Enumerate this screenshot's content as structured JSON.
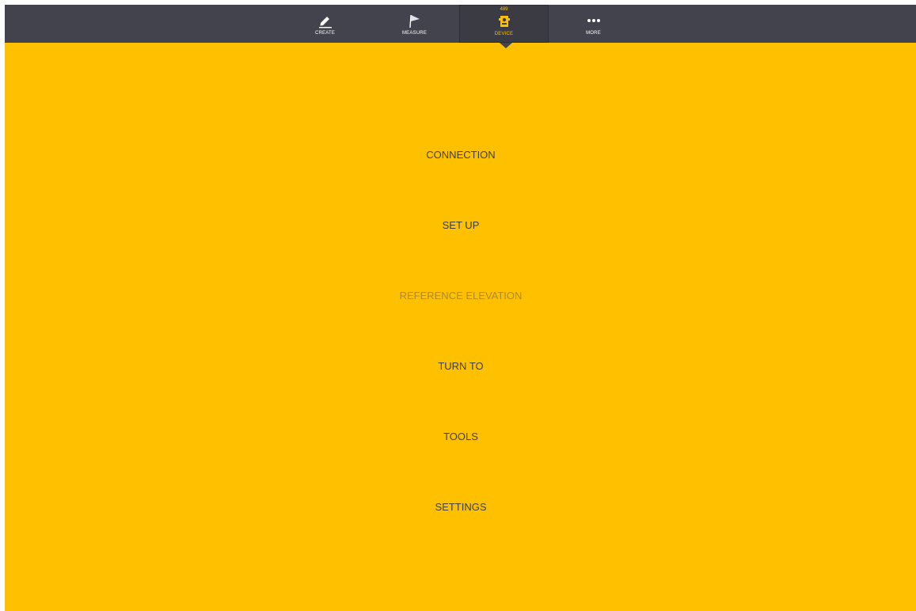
{
  "nav": {
    "items": [
      {
        "id": "create",
        "label": "CREATE",
        "icon": "pencil-icon"
      },
      {
        "id": "measure",
        "label": "MEASURE",
        "icon": "flag-icon"
      },
      {
        "id": "device",
        "label": "DEVICE",
        "icon": "device-icon",
        "badge": "489",
        "active": true
      },
      {
        "id": "more",
        "label": "MORE",
        "icon": "ellipsis-icon"
      }
    ]
  },
  "menu": {
    "connection": "CONNECTION",
    "setup": "SET UP",
    "reference_elevation": "REFERENCE ELEVATION",
    "turn_to": "TURN TO",
    "tools": "TOOLS",
    "settings": "SETTINGS"
  },
  "colors": {
    "background": "#FFC000",
    "topbar": "#43434d",
    "accent": "#FFC000",
    "text": "#3f3f3f",
    "disabled_text": "#a88a3a"
  }
}
